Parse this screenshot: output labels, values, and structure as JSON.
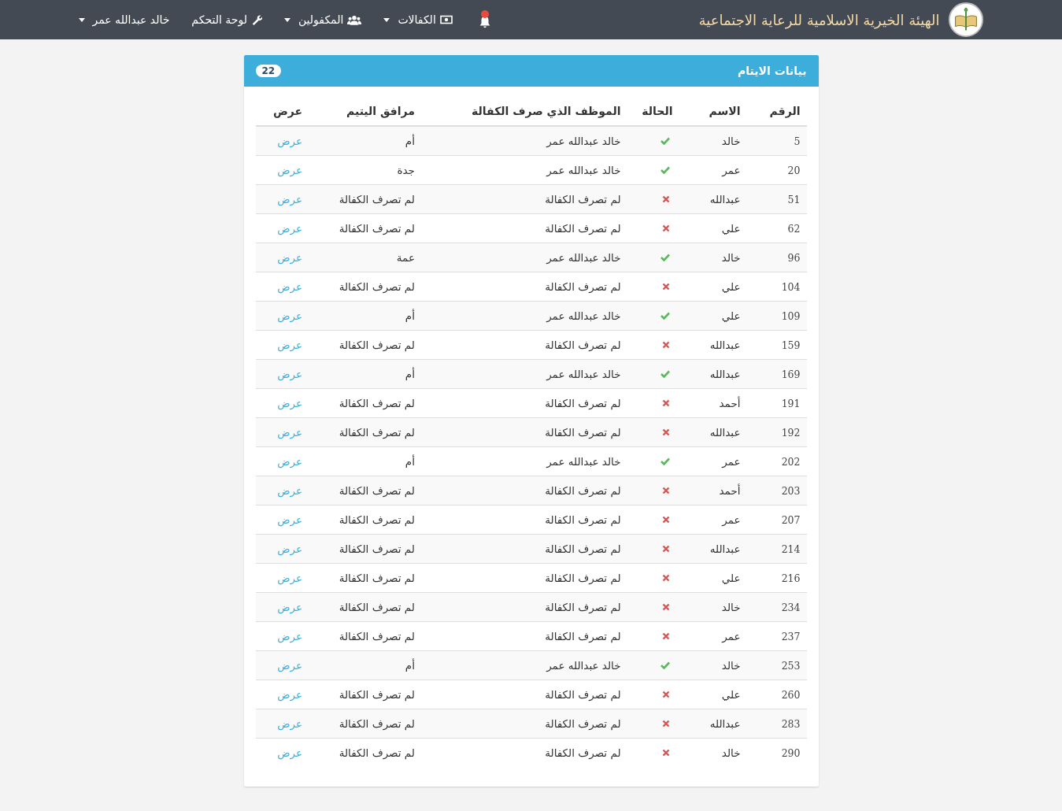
{
  "navbar": {
    "brand": "الهيئة الخيرية الاسلامية للرعاية الاجتماعية",
    "notifications": {
      "unread": true
    },
    "items": [
      {
        "kind": "cash",
        "label": "الكفالات",
        "dropdown": true
      },
      {
        "kind": "group",
        "label": "المكفولين",
        "dropdown": true
      },
      {
        "kind": "tool",
        "label": "لوحة التحكم",
        "dropdown": false
      },
      {
        "kind": "account",
        "label": "خالد عبدالله عمر",
        "dropdown": true
      }
    ]
  },
  "panel": {
    "title": "بيانات الايتام",
    "count": "22",
    "columns": [
      "الرقم",
      "الاسم",
      "الحالة",
      "الموظف الذي صرف الكفالة",
      "مرافق اليتيم",
      "عرض"
    ],
    "rows": [
      {
        "number": "5",
        "name": "خالد",
        "paid": true,
        "employee": "خالد عبدالله عمر",
        "companion": "أم",
        "action": "عرض"
      },
      {
        "number": "20",
        "name": "عمر",
        "paid": true,
        "employee": "خالد عبدالله عمر",
        "companion": "جدة",
        "action": "عرض"
      },
      {
        "number": "51",
        "name": "عبدالله",
        "paid": false,
        "employee": "لم تصرف الكفالة",
        "companion": "لم تصرف الكفالة",
        "action": "عرض"
      },
      {
        "number": "62",
        "name": "علي",
        "paid": false,
        "employee": "لم تصرف الكفالة",
        "companion": "لم تصرف الكفالة",
        "action": "عرض"
      },
      {
        "number": "96",
        "name": "خالد",
        "paid": true,
        "employee": "خالد عبدالله عمر",
        "companion": "عمة",
        "action": "عرض"
      },
      {
        "number": "104",
        "name": "علي",
        "paid": false,
        "employee": "لم تصرف الكفالة",
        "companion": "لم تصرف الكفالة",
        "action": "عرض"
      },
      {
        "number": "109",
        "name": "علي",
        "paid": true,
        "employee": "خالد عبدالله عمر",
        "companion": "أم",
        "action": "عرض"
      },
      {
        "number": "159",
        "name": "عبدالله",
        "paid": false,
        "employee": "لم تصرف الكفالة",
        "companion": "لم تصرف الكفالة",
        "action": "عرض"
      },
      {
        "number": "169",
        "name": "عبدالله",
        "paid": true,
        "employee": "خالد عبدالله عمر",
        "companion": "أم",
        "action": "عرض"
      },
      {
        "number": "191",
        "name": "أحمد",
        "paid": false,
        "employee": "لم تصرف الكفالة",
        "companion": "لم تصرف الكفالة",
        "action": "عرض"
      },
      {
        "number": "192",
        "name": "عبدالله",
        "paid": false,
        "employee": "لم تصرف الكفالة",
        "companion": "لم تصرف الكفالة",
        "action": "عرض"
      },
      {
        "number": "202",
        "name": "عمر",
        "paid": true,
        "employee": "خالد عبدالله عمر",
        "companion": "أم",
        "action": "عرض"
      },
      {
        "number": "203",
        "name": "أحمد",
        "paid": false,
        "employee": "لم تصرف الكفالة",
        "companion": "لم تصرف الكفالة",
        "action": "عرض"
      },
      {
        "number": "207",
        "name": "عمر",
        "paid": false,
        "employee": "لم تصرف الكفالة",
        "companion": "لم تصرف الكفالة",
        "action": "عرض"
      },
      {
        "number": "214",
        "name": "عبدالله",
        "paid": false,
        "employee": "لم تصرف الكفالة",
        "companion": "لم تصرف الكفالة",
        "action": "عرض"
      },
      {
        "number": "216",
        "name": "علي",
        "paid": false,
        "employee": "لم تصرف الكفالة",
        "companion": "لم تصرف الكفالة",
        "action": "عرض"
      },
      {
        "number": "234",
        "name": "خالد",
        "paid": false,
        "employee": "لم تصرف الكفالة",
        "companion": "لم تصرف الكفالة",
        "action": "عرض"
      },
      {
        "number": "237",
        "name": "عمر",
        "paid": false,
        "employee": "لم تصرف الكفالة",
        "companion": "لم تصرف الكفالة",
        "action": "عرض"
      },
      {
        "number": "253",
        "name": "خالد",
        "paid": true,
        "employee": "خالد عبدالله عمر",
        "companion": "أم",
        "action": "عرض"
      },
      {
        "number": "260",
        "name": "علي",
        "paid": false,
        "employee": "لم تصرف الكفالة",
        "companion": "لم تصرف الكفالة",
        "action": "عرض"
      },
      {
        "number": "283",
        "name": "عبدالله",
        "paid": false,
        "employee": "لم تصرف الكفالة",
        "companion": "لم تصرف الكفالة",
        "action": "عرض"
      },
      {
        "number": "290",
        "name": "خالد",
        "paid": false,
        "employee": "لم تصرف الكفالة",
        "companion": "لم تصرف الكفالة",
        "action": "عرض"
      }
    ]
  }
}
